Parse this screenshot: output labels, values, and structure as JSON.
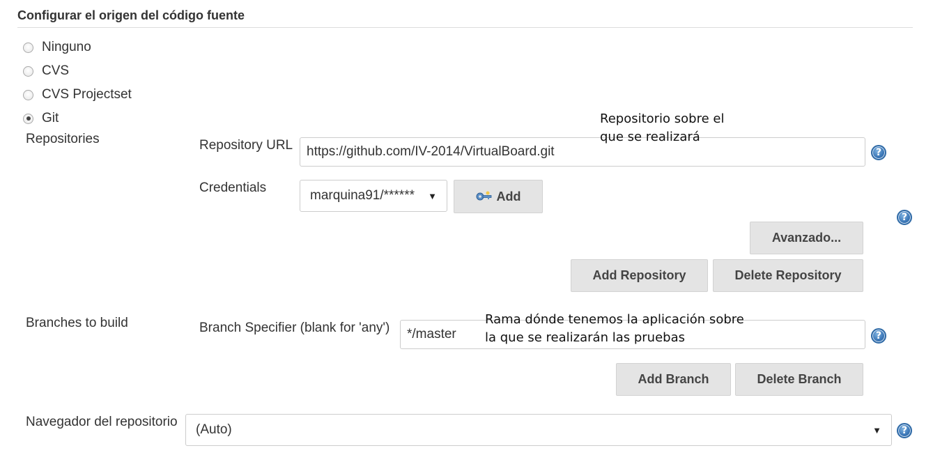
{
  "section": {
    "title": "Configurar el origen del código fuente"
  },
  "scm_options": [
    {
      "label": "Ninguno",
      "checked": false
    },
    {
      "label": "CVS",
      "checked": false
    },
    {
      "label": "CVS Projectset",
      "checked": false
    },
    {
      "label": "Git",
      "checked": true
    }
  ],
  "repositories": {
    "label": "Repositories",
    "url_label": "Repository URL",
    "url_value": "https://github.com/IV-2014/VirtualBoard.git",
    "credentials_label": "Credentials",
    "credentials_value": "marquina91/******",
    "add_label": "Add",
    "advanced_label": "Avanzado...",
    "add_repository_label": "Add Repository",
    "delete_repository_label": "Delete Repository"
  },
  "branches": {
    "label": "Branches to build",
    "specifier_label": "Branch Specifier (blank for 'any')",
    "specifier_value": "*/master",
    "add_branch_label": "Add Branch",
    "delete_branch_label": "Delete Branch"
  },
  "browser": {
    "label": "Navegador del repositorio",
    "value": "(Auto)"
  },
  "annotations": {
    "repo_line1": "Repositorio sobre el",
    "repo_line2": "que se realizará",
    "branch_line1": "Rama dónde tenemos la aplicación sobre",
    "branch_line2": "la que se realizarán las pruebas"
  },
  "help_glyph": "?",
  "dropdown_caret": "▼"
}
